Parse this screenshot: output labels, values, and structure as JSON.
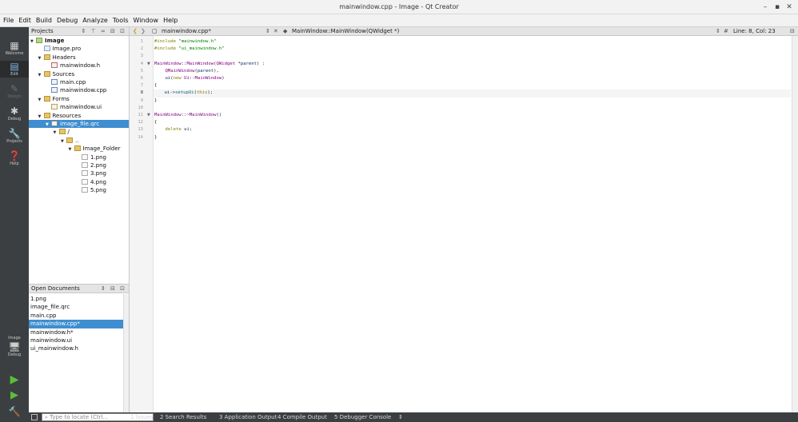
{
  "window": {
    "title": "mainwindow.cpp - Image - Qt Creator",
    "controls": [
      "–",
      "▪",
      "✕"
    ]
  },
  "menu": [
    "File",
    "Edit",
    "Build",
    "Debug",
    "Analyze",
    "Tools",
    "Window",
    "Help"
  ],
  "modes": {
    "welcome": "Welcome",
    "edit": "Edit",
    "design": "Design",
    "debug": "Debug",
    "projects": "Projects",
    "help": "Help",
    "kit_project": "Image",
    "kit_config": "Debug"
  },
  "projects_pane": {
    "title": "Projects",
    "tree": [
      {
        "label": "Image",
        "depth": 0,
        "arrow": "▼",
        "icon": "project",
        "bold": true
      },
      {
        "label": "Image.pro",
        "depth": 1,
        "arrow": "",
        "icon": "pro"
      },
      {
        "label": "Headers",
        "depth": 1,
        "arrow": "▼",
        "icon": "folder"
      },
      {
        "label": "mainwindow.h",
        "depth": 2,
        "arrow": "",
        "icon": "h"
      },
      {
        "label": "Sources",
        "depth": 1,
        "arrow": "▼",
        "icon": "folder"
      },
      {
        "label": "main.cpp",
        "depth": 2,
        "arrow": "",
        "icon": "cpp"
      },
      {
        "label": "mainwindow.cpp",
        "depth": 2,
        "arrow": "",
        "icon": "cpp"
      },
      {
        "label": "Forms",
        "depth": 1,
        "arrow": "▼",
        "icon": "folder"
      },
      {
        "label": "mainwindow.ui",
        "depth": 2,
        "arrow": "",
        "icon": "ui"
      },
      {
        "label": "Resources",
        "depth": 1,
        "arrow": "▼",
        "icon": "folder"
      },
      {
        "label": "image_file.qrc",
        "depth": 2,
        "arrow": "▼",
        "icon": "qrc",
        "selected": true
      },
      {
        "label": "/",
        "depth": 3,
        "arrow": "▼",
        "icon": "folder"
      },
      {
        "label": "..",
        "depth": 4,
        "arrow": "▼",
        "icon": "folder"
      },
      {
        "label": "Image_Folder",
        "depth": 5,
        "arrow": "▼",
        "icon": "folder"
      },
      {
        "label": "1.png",
        "depth": 6,
        "arrow": "",
        "icon": "png"
      },
      {
        "label": "2.png",
        "depth": 6,
        "arrow": "",
        "icon": "png"
      },
      {
        "label": "3.png",
        "depth": 6,
        "arrow": "",
        "icon": "png"
      },
      {
        "label": "4.png",
        "depth": 6,
        "arrow": "",
        "icon": "png"
      },
      {
        "label": "5.png",
        "depth": 6,
        "arrow": "",
        "icon": "png"
      }
    ]
  },
  "open_documents": {
    "title": "Open Documents",
    "items": [
      {
        "label": "1.png"
      },
      {
        "label": "image_file.qrc"
      },
      {
        "label": "main.cpp"
      },
      {
        "label": "mainwindow.cpp*",
        "selected": true
      },
      {
        "label": "mainwindow.h*"
      },
      {
        "label": "mainwindow.ui"
      },
      {
        "label": "ui_mainwindow.h"
      }
    ]
  },
  "editor": {
    "file_tab": "mainwindow.cpp*",
    "symbol": "MainWindow::MainWindow(QWidget *)",
    "position": "Line: 8, Col: 23",
    "current_line": 8,
    "lines": [
      "#include \"mainwindow.h\"",
      "#include \"ui_mainwindow.h\"",
      "",
      "MainWindow::MainWindow(QWidget *parent) :",
      "    QMainWindow(parent),",
      "    ui(new Ui::MainWindow)",
      "{",
      "    ui->setupUi(this);",
      "}",
      "",
      "MainWindow::~MainWindow()",
      "{",
      "    delete ui;",
      "}"
    ]
  },
  "output_bar": {
    "locate_placeholder": "Type to locate (Ctrl...",
    "tabs": [
      "1 Issues",
      "2 Search Results",
      "3 Application Output",
      "4 Compile Output",
      "5 Debugger Console"
    ]
  }
}
